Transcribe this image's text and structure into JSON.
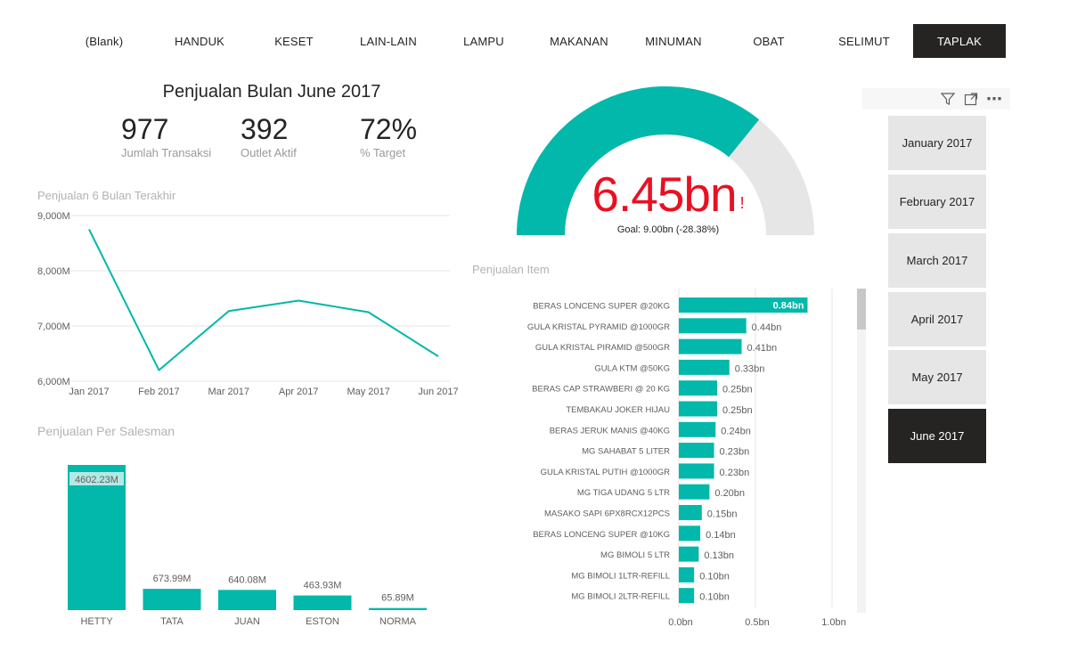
{
  "category_slicer": {
    "items": [
      {
        "label": "(Blank)",
        "active": false
      },
      {
        "label": "HANDUK",
        "active": false
      },
      {
        "label": "KESET",
        "active": false
      },
      {
        "label": "LAIN-LAIN",
        "active": false
      },
      {
        "label": "LAMPU",
        "active": false
      },
      {
        "label": "MAKANAN",
        "active": false
      },
      {
        "label": "MINUMAN",
        "active": false
      },
      {
        "label": "OBAT",
        "active": false
      },
      {
        "label": "SELIMUT",
        "active": false
      },
      {
        "label": "TAPLAK",
        "active": true
      }
    ]
  },
  "kpi": {
    "title": "Penjualan Bulan June 2017",
    "cards": [
      {
        "value": "977",
        "label": "Jumlah Transaksi"
      },
      {
        "value": "392",
        "label": "Outlet Aktif"
      },
      {
        "value": "72%",
        "label": "% Target"
      }
    ]
  },
  "gauge": {
    "value_text": "6.45bn",
    "alert_mark": "!",
    "goal_text": "Goal: 9.00bn (-28.38%)",
    "fill_fraction": 0.7167,
    "colors": {
      "fill": "#01b8aa",
      "track": "#e6e6e6",
      "value": "#e81123"
    }
  },
  "line_chart": {
    "title": "Penjualan 6 Bulan Terakhir",
    "chart_data": {
      "type": "line",
      "categories": [
        "Jan 2017",
        "Feb 2017",
        "Mar 2017",
        "Apr 2017",
        "May 2017",
        "Jun 2017"
      ],
      "values": [
        8750,
        6200,
        7270,
        7460,
        7250,
        6450
      ],
      "ylim": [
        6000,
        9000
      ],
      "yticks": [
        "9,000M",
        "8,000M",
        "7,000M",
        "6,000M"
      ],
      "color": "#01b8aa"
    }
  },
  "salesman_chart": {
    "title": "Penjualan Per Salesman",
    "chart_data": {
      "type": "bar",
      "categories": [
        "HETTY",
        "TATA",
        "JUAN",
        "ESTON",
        "NORMA"
      ],
      "values": [
        4602.23,
        673.99,
        640.08,
        463.93,
        65.89
      ],
      "labels": [
        "4602.23M",
        "673.99M",
        "640.08M",
        "463.93M",
        "65.89M"
      ],
      "color": "#01b8aa"
    }
  },
  "item_chart": {
    "title": "Penjualan Item",
    "chart_data": {
      "type": "bar",
      "orientation": "horizontal",
      "categories": [
        "BERAS LONCENG SUPER @20KG",
        "GULA KRISTAL PYRAMID @1000GR",
        "GULA KRISTAL PIRAMID @500GR",
        "GULA KTM @50KG",
        "BERAS CAP STRAWBERI @ 20 KG",
        "TEMBAKAU JOKER HIJAU",
        "BERAS JERUK MANIS @40KG",
        "MG SAHABAT 5 LITER",
        "GULA KRISTAL PUTIH @1000GR",
        "MG TIGA UDANG 5 LTR",
        "MASAKO SAPI 6PX8RCX12PCS",
        "BERAS LONCENG SUPER @10KG",
        "MG BIMOLI 5 LTR",
        "MG BIMOLI 1LTR-REFILL",
        "MG BIMOLI 2LTR-REFILL"
      ],
      "values": [
        0.84,
        0.44,
        0.41,
        0.33,
        0.25,
        0.25,
        0.24,
        0.23,
        0.23,
        0.2,
        0.15,
        0.14,
        0.13,
        0.1,
        0.1
      ],
      "labels": [
        "0.84bn",
        "0.44bn",
        "0.41bn",
        "0.33bn",
        "0.25bn",
        "0.25bn",
        "0.24bn",
        "0.23bn",
        "0.23bn",
        "0.20bn",
        "0.15bn",
        "0.14bn",
        "0.13bn",
        "0.10bn",
        "0.10bn"
      ],
      "xlim": [
        0,
        1.0
      ],
      "xticks": [
        "0.0bn",
        "0.5bn",
        "1.0bn"
      ],
      "color": "#01b8aa"
    }
  },
  "month_slicer": {
    "toolbar": {
      "filter_icon": "filter-icon",
      "focus_icon": "focus-mode-icon",
      "more_icon": "more-options-icon",
      "more_glyph": "⋯"
    },
    "items": [
      {
        "label": "January 2017",
        "active": false
      },
      {
        "label": "February 2017",
        "active": false
      },
      {
        "label": "March 2017",
        "active": false
      },
      {
        "label": "April 2017",
        "active": false
      },
      {
        "label": "May 2017",
        "active": false
      },
      {
        "label": "June 2017",
        "active": true
      }
    ]
  }
}
